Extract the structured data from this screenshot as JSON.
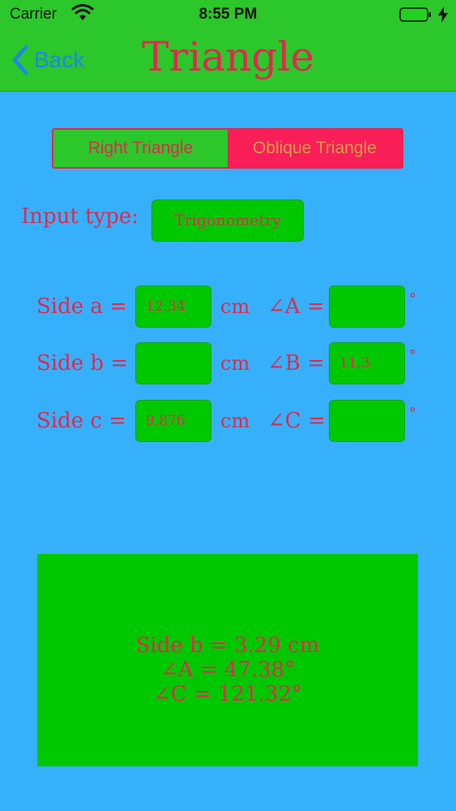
{
  "status": {
    "carrier": "Carrier",
    "time": "8:55 PM"
  },
  "nav": {
    "back_label": "Back",
    "title": "Triangle"
  },
  "segmented": {
    "options": [
      "Right Triangle",
      "Oblique Triangle"
    ],
    "selected": "Oblique Triangle"
  },
  "input_type": {
    "label": "Input type:",
    "value": "Trigonometry"
  },
  "rows": [
    {
      "side_label": "Side a =",
      "side_value": "12.34",
      "unit": "cm",
      "angle_label": "∠A =",
      "angle_value": "",
      "degree": "°"
    },
    {
      "side_label": "Side b =",
      "side_value": "",
      "unit": "cm",
      "angle_label": "∠B =",
      "angle_value": "11.3",
      "degree": "°"
    },
    {
      "side_label": "Side c =",
      "side_value": "9.876",
      "unit": "cm",
      "angle_label": "∠C =",
      "angle_value": "",
      "degree": "°"
    }
  ],
  "result": {
    "lines": [
      "Side b = 3.29 cm",
      "∠A = 47.38°",
      "∠C = 121.32°"
    ]
  },
  "colors": {
    "background": "#37b0fb",
    "bar": "#2cc72a",
    "field": "#00c800",
    "text": "#e0294f",
    "active_segment": "#f91e58",
    "back": "#1e86f0"
  },
  "icons": {
    "back": "chevron-left-icon",
    "wifi": "wifi-icon",
    "battery": "battery-icon",
    "charging": "bolt-icon"
  }
}
